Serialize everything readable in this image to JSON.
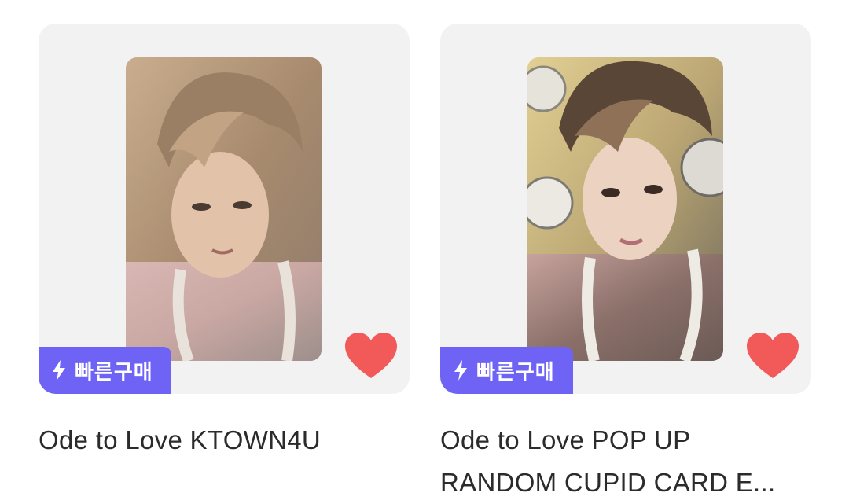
{
  "products": [
    {
      "title": "Ode to Love KTOWN4U",
      "badge": "빠른구매",
      "liked": true,
      "photo_icon": "photocard-image"
    },
    {
      "title_line1": "Ode to Love POP UP",
      "title_line2": "RANDOM CUPID CARD E...",
      "badge": "빠른구매",
      "liked": true,
      "photo_icon": "photocard-image"
    }
  ],
  "colors": {
    "badge_bg": "#6f63f5",
    "heart": "#f25a5a",
    "card_bg": "#f2f2f2",
    "text": "#2b2b2b"
  },
  "icons": {
    "badge": "lightning-bolt-icon",
    "like": "heart-icon"
  }
}
